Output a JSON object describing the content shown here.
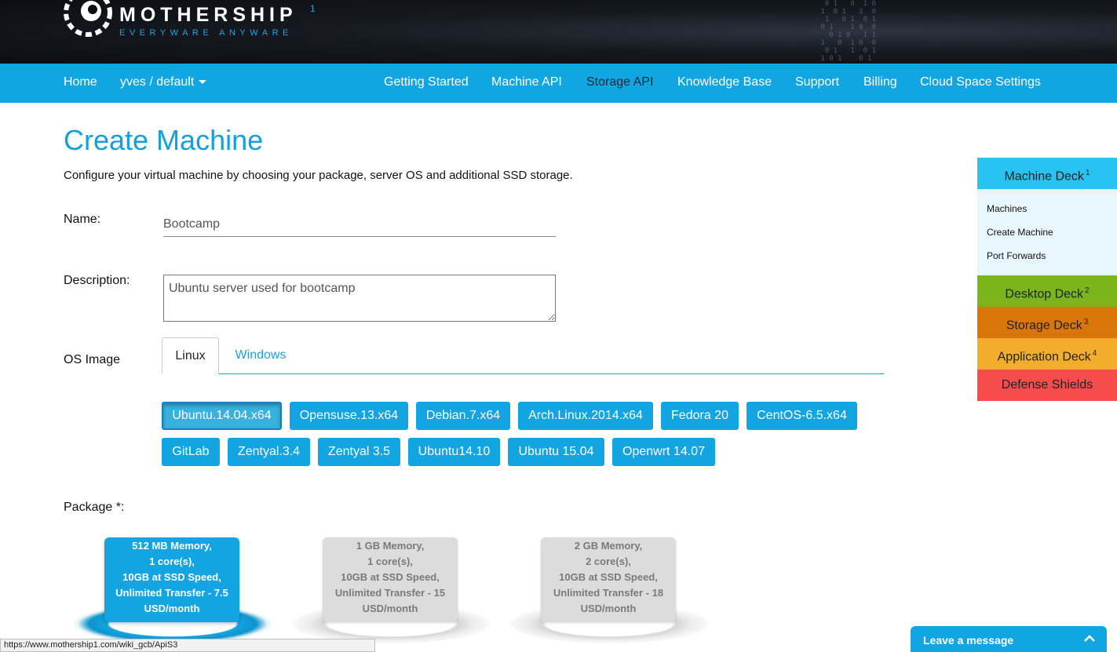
{
  "header": {
    "brand": "MOTHERSHIP",
    "brand_sup": "1",
    "tagline": "EVERYWARE ANYWARE"
  },
  "nav": {
    "home": "Home",
    "account": "yves / default",
    "items": [
      "Getting Started",
      "Machine API",
      "Storage API",
      "Knowledge Base",
      "Support",
      "Billing",
      "Cloud Space Settings"
    ],
    "active": "Storage API"
  },
  "main": {
    "title": "Create Machine",
    "description": "Configure your virtual machine by choosing your package, server OS and additional SSD storage.",
    "name_label": "Name:",
    "name_value": "Bootcamp",
    "description_label": "Description:",
    "description_value": "Ubuntu server used for bootcamp",
    "os_label": "OS Image",
    "tabs": [
      "Linux",
      "Windows"
    ],
    "os_images": [
      "Ubuntu.14.04.x64",
      "Opensuse.13.x64",
      "Debian.7.x64",
      "Arch.Linux.2014.x64",
      "Fedora 20",
      "CentOS-6.5.x64",
      "GitLab",
      "Zentyal.3.4",
      "Zentyal 3.5",
      "Ubuntu14.10",
      "Ubuntu 15.04",
      "Openwrt 14.07"
    ],
    "selected_os": "Ubuntu.14.04.x64",
    "package_label": "Package *:",
    "packages": [
      {
        "lines": [
          "512 MB Memory,",
          "1 core(s),",
          "10GB at SSD Speed,",
          "Unlimited Transfer - 7.5",
          "USD/month"
        ],
        "selected": true
      },
      {
        "lines": [
          "1 GB Memory,",
          "1 core(s),",
          "10GB at SSD Speed,",
          "Unlimited Transfer - 15",
          "USD/month"
        ],
        "selected": false
      },
      {
        "lines": [
          "2 GB Memory,",
          "2 core(s),",
          "10GB at SSD Speed,",
          "Unlimited Transfer - 18",
          "USD/month"
        ],
        "selected": false
      }
    ]
  },
  "decks": {
    "items": [
      {
        "label": "Machine Deck",
        "num": "1",
        "color": "#27c3f2"
      },
      {
        "label": "Desktop Deck",
        "num": "2",
        "color": "#7ab51d"
      },
      {
        "label": "Storage Deck",
        "num": "3",
        "color": "#d9760a"
      },
      {
        "label": "Application Deck",
        "num": "4",
        "color": "#f3ad2d"
      },
      {
        "label": "Defense Shields",
        "num": "",
        "color": "#f74c4c"
      }
    ],
    "machine_links": [
      "Machines",
      "Create Machine",
      "Port Forwards"
    ]
  },
  "status_url": "https://www.mothership1.com/wiki_gcb/ApiS3",
  "chat": {
    "label": "Leave a message"
  }
}
